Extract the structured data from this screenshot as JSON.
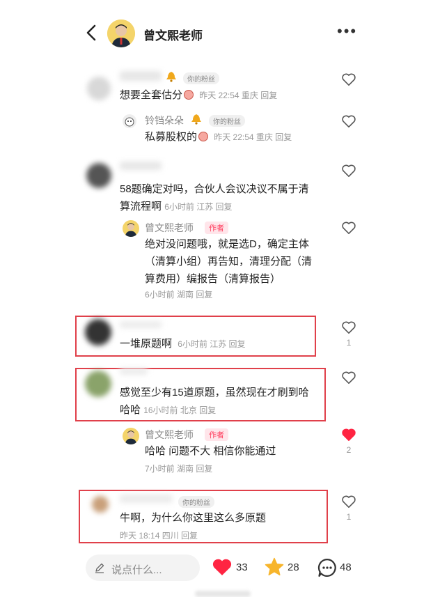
{
  "header": {
    "title": "曾文熙老师"
  },
  "comments": [
    {
      "badge": "你的粉丝",
      "text": "想要全套估分",
      "meta": "昨天 22:54 重庆 回复",
      "reply": {
        "name": "铃铛朵朵",
        "badge": "你的粉丝",
        "text": "私募股权的",
        "meta": "昨天 22:54 重庆 回复"
      }
    },
    {
      "text": "58题确定对吗，合伙人会议决议不属于清算流程啊",
      "line1": "58题确定对吗，合伙人会议决议不属于清",
      "line2": "算流程啊",
      "meta": "6小时前 江苏 回复",
      "reply": {
        "name": "曾文熙老师",
        "badge": "作者",
        "line1": "绝对没问题哦，就是选D，确定主体",
        "line2": "（清算小组）再告知，清理分配（清",
        "line3": "算费用）编报告（清算报告）",
        "meta": "6小时前 湖南 回复"
      }
    },
    {
      "text": "一堆原题啊",
      "meta": "6小时前 江苏 回复",
      "likes": "1"
    },
    {
      "line1": "感觉至少有15道原题，虽然现在才刷到哈",
      "line2": "哈哈",
      "meta": "16小时前 北京 回复",
      "reply": {
        "name": "曾文熙老师",
        "badge": "作者",
        "text": "哈哈 问题不大 相信你能通过",
        "meta": "7小时前 湖南 回复",
        "likes": "2",
        "liked": true
      }
    },
    {
      "badge": "你的粉丝",
      "text": "牛啊，为什么你这里这么多原题",
      "meta": "昨天 18:14 四川 回复",
      "likes": "1"
    }
  ],
  "bottom_bar": {
    "placeholder": "说点什么...",
    "likes": "33",
    "favorites": "28",
    "comments": "48"
  },
  "colors": {
    "accent_red": "#ff2442",
    "star": "#f7b52c",
    "highlight_box": "#e0404a"
  }
}
